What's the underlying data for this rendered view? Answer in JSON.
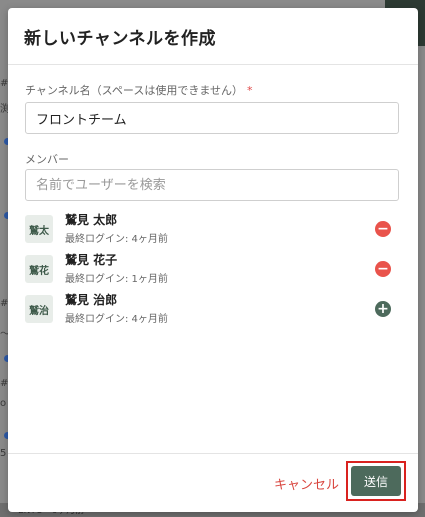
{
  "background": {
    "left_fragments": [
      "#",
      "渕",
      "#",
      "〜",
      "#",
      "o",
      "5"
    ],
    "bottom_fragment": "ENTO · 6ヶ月前"
  },
  "modal": {
    "title": "新しいチャンネルを作成",
    "channel_name": {
      "label": "チャンネル名（スペースは使用できません）",
      "required_mark": "*",
      "value": "フロントチーム"
    },
    "members": {
      "label": "メンバー",
      "search_placeholder": "名前でユーザーを検索",
      "list": [
        {
          "avatar": "鷲太",
          "name": "鷲見 太郎",
          "last_login": "最終ログイン: 4ヶ月前",
          "action": "remove"
        },
        {
          "avatar": "鷲花",
          "name": "鷲見 花子",
          "last_login": "最終ログイン: 1ヶ月前",
          "action": "remove"
        },
        {
          "avatar": "鷲治",
          "name": "鷲見 治郎",
          "last_login": "最終ログイン: 4ヶ月前",
          "action": "add"
        }
      ]
    },
    "footer": {
      "cancel_label": "キャンセル",
      "submit_label": "送信"
    }
  },
  "colors": {
    "accent": "#4d6a5c",
    "danger": "#e9534b",
    "highlight_border": "#d9221f"
  }
}
